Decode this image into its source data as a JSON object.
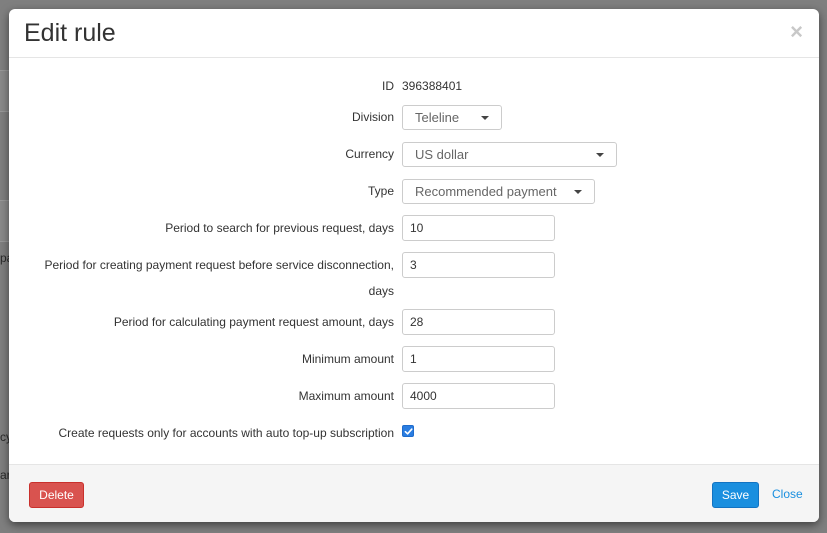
{
  "background": {
    "fragments": [
      "pa",
      "cy",
      "ar"
    ]
  },
  "modal": {
    "title": "Edit rule",
    "close_glyph": "×"
  },
  "form": {
    "id": {
      "label": "ID",
      "value": "396388401"
    },
    "division": {
      "label": "Division",
      "value": "Teleline"
    },
    "currency": {
      "label": "Currency",
      "value": "US dollar"
    },
    "type": {
      "label": "Type",
      "value": "Recommended payment"
    },
    "period_search": {
      "label": "Period to search for previous request, days",
      "value": "10"
    },
    "period_creating": {
      "label_line1": "Period for creating payment request before service disconnection,",
      "label_line2": "days",
      "value": "3"
    },
    "period_calculating": {
      "label": "Period for calculating payment request amount, days",
      "value": "28"
    },
    "minimum_amount": {
      "label": "Minimum amount",
      "value": "1"
    },
    "maximum_amount": {
      "label": "Maximum amount",
      "value": "4000"
    },
    "auto_topup": {
      "label": "Create requests only for accounts with auto top-up subscription",
      "checked": true
    }
  },
  "footer": {
    "delete_label": "Delete",
    "save_label": "Save",
    "close_label": "Close"
  },
  "colors": {
    "primary": "#1a8fdf",
    "danger": "#d9534f",
    "backdrop": "#7f7f7f"
  }
}
